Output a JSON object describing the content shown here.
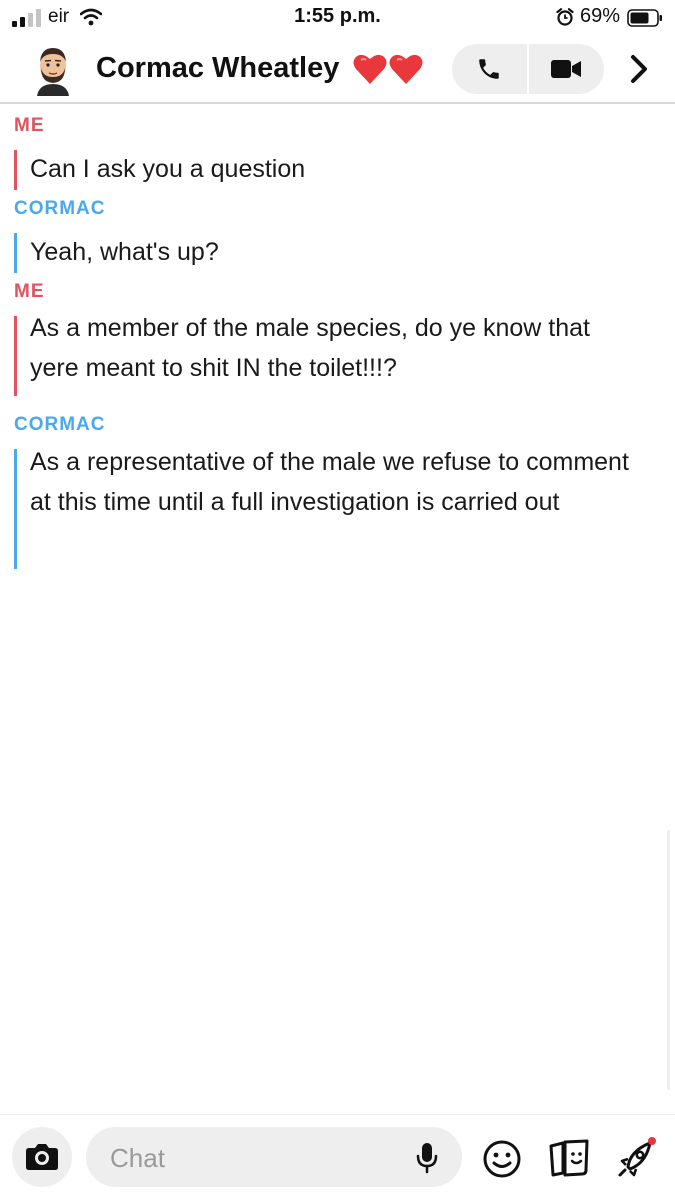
{
  "status_bar": {
    "carrier": "eir",
    "time": "1:55 p.m.",
    "battery": "69%"
  },
  "header": {
    "contact_name": "Cormac Wheatley",
    "icons": [
      "avatar",
      "heart-icon",
      "phone-icon",
      "video-icon",
      "chevron-right-icon"
    ]
  },
  "messages": [
    {
      "sender": "ME",
      "text": "Can I ask you a question",
      "color": "#e0535f"
    },
    {
      "sender": "CORMAC",
      "text": "Yeah, what's up?",
      "color": "#4aa8ef"
    },
    {
      "sender": "ME",
      "text": "As a member of the male species, do ye know that yere meant to shit IN the toilet!!!?",
      "color": "#e0535f"
    },
    {
      "sender": "CORMAC",
      "text": "As a representative of the male we refuse to comment at this time until a full investigation is carried out",
      "color": "#4aa8ef"
    }
  ],
  "composer": {
    "placeholder": "Chat",
    "icons": [
      "camera-icon",
      "mic-icon",
      "smiley-icon",
      "sticker-icon",
      "rocket-icon"
    ]
  }
}
